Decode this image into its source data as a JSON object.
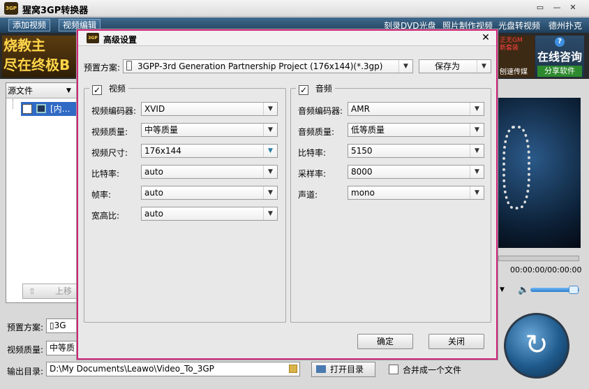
{
  "app": {
    "title": "猩窝3GP转换器",
    "logo_text": "3GP"
  },
  "window_controls": {
    "minimize": "▭",
    "maximize": "—",
    "close": "✕"
  },
  "toolbar": {
    "add_video": "添加视频",
    "edit_video": "视频编辑"
  },
  "top_links": [
    "刻录DVD光盘",
    "照片制作视频",
    "光盘转视频",
    "德州扑克"
  ],
  "banner": {
    "ad_left": [
      "烧教主",
      "尽在终极B"
    ],
    "ad_right_lines": [
      "正无GM",
      "新套装"
    ],
    "ad_right_bottom": "刨速传媒",
    "consult": {
      "icon": "?",
      "title": "在线咨询",
      "share": "分享软件"
    }
  },
  "source_panel": {
    "header": "源文件",
    "item": "[内…",
    "up_button": "上移"
  },
  "player": {
    "time": "00:00:00/00:00:00",
    "volume": 0.9
  },
  "bottom": {
    "preset_label": "预置方案:",
    "preset_value": "3G",
    "quality_label": "视频质量:",
    "quality_value": "中等质",
    "output_label": "输出目录:",
    "output_value": "D:\\My Documents\\Leawo\\Video_To_3GP",
    "open_folder": "打开目录",
    "merge_label": "合并成一个文件"
  },
  "dialog": {
    "title": "高级设置",
    "close": "✕",
    "preset_label": "预置方案:",
    "preset_value": "3GPP-3rd Generation Partnership Project (176x144)(*.3gp)",
    "save_as": "保存为",
    "video": {
      "title": "视频",
      "enabled": true,
      "fields": [
        {
          "label": "视频编码器:",
          "value": "XVID"
        },
        {
          "label": "视频质量:",
          "value": "中等质量"
        },
        {
          "label": "视频尺寸:",
          "value": "176x144"
        },
        {
          "label": "比特率:",
          "value": "auto"
        },
        {
          "label": "帧率:",
          "value": "auto"
        },
        {
          "label": "宽高比:",
          "value": "auto"
        }
      ]
    },
    "audio": {
      "title": "音频",
      "enabled": true,
      "fields": [
        {
          "label": "音频编码器:",
          "value": "AMR"
        },
        {
          "label": "音频质量:",
          "value": "低等质量"
        },
        {
          "label": "比特率:",
          "value": "5150"
        },
        {
          "label": "采样率:",
          "value": "8000"
        },
        {
          "label": "声道:",
          "value": "mono"
        }
      ]
    },
    "ok": "确定",
    "close_button": "关闭"
  },
  "colors": {
    "dialog_border": "#d0247a",
    "menubar": "#2a5275",
    "selection": "#316ac5"
  }
}
